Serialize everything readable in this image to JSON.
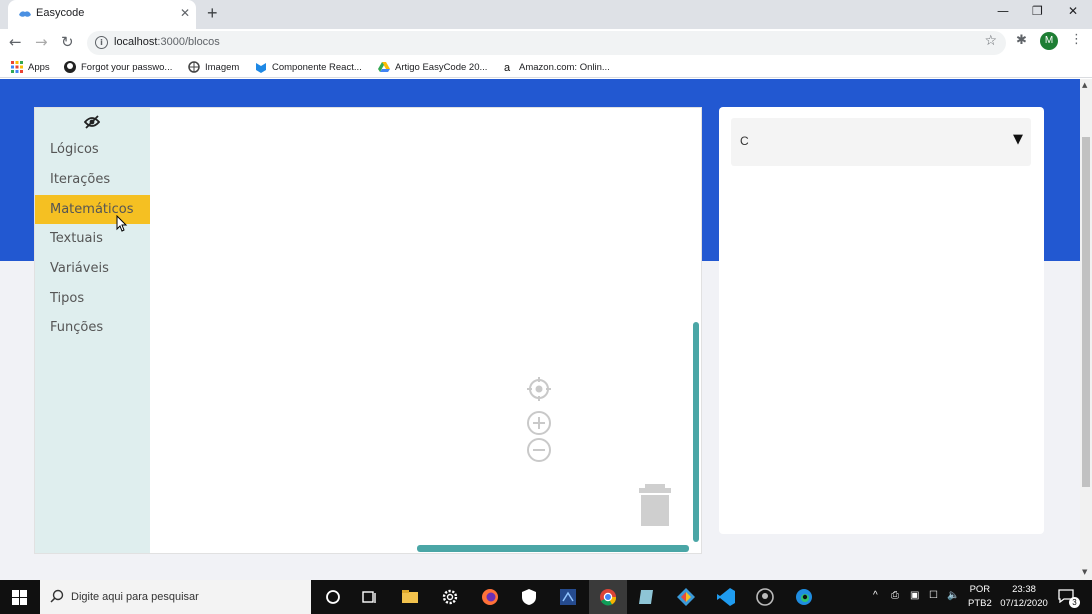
{
  "browser": {
    "tab": {
      "title": "Easycode"
    },
    "address": {
      "host": "localhost",
      "path": ":3000/blocos"
    },
    "profile_initial": "M",
    "bookmarks": [
      {
        "label": "Apps",
        "icon": "apps-grid-icon"
      },
      {
        "label": "Forgot your passwo...",
        "icon": "github-icon"
      },
      {
        "label": "Imagem",
        "icon": "globe-icon"
      },
      {
        "label": "Componente React...",
        "icon": "material-icon"
      },
      {
        "label": "Artigo EasyCode 20...",
        "icon": "drive-icon"
      },
      {
        "label": "Amazon.com: Onlin...",
        "icon": "amazon-icon"
      }
    ]
  },
  "toolbox": {
    "categories": [
      {
        "label": "Lógicos"
      },
      {
        "label": "Iterações"
      },
      {
        "label": "Matemáticos",
        "active": true
      },
      {
        "label": "Textuais"
      },
      {
        "label": "Variáveis"
      },
      {
        "label": "Tipos"
      },
      {
        "label": "Funções"
      }
    ]
  },
  "language_select": {
    "value": "C",
    "arrow": "▼"
  },
  "taskbar": {
    "search_placeholder": "Digite aqui para pesquisar",
    "language": {
      "line1": "POR",
      "line2": "PTB2"
    },
    "time": "23:38",
    "date": "07/12/2020",
    "notification_count": "3"
  },
  "colors": {
    "hero": "#2258d1",
    "toolbox_bg": "#dfeeee",
    "active_category": "#f5c022",
    "scrollbars": "#4aa6a6"
  }
}
